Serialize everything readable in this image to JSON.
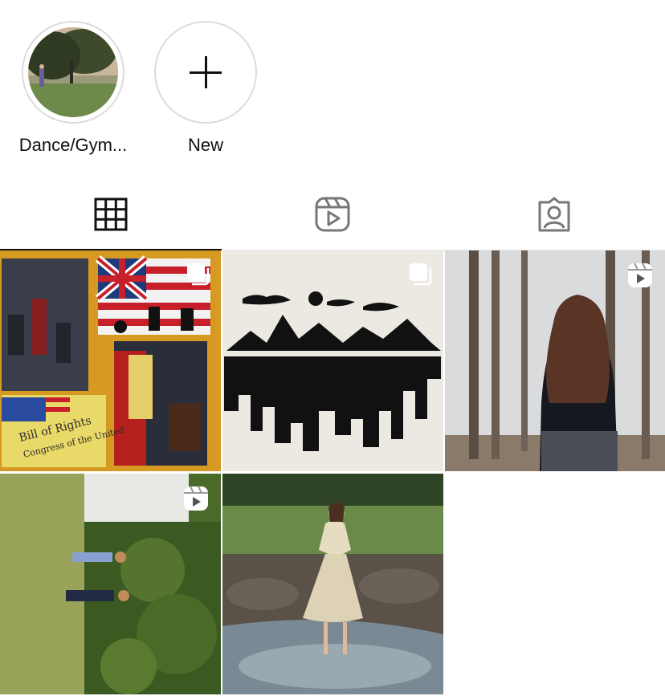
{
  "highlights": [
    {
      "label": "Dance/Gym..."
    },
    {
      "label": "New"
    }
  ],
  "tabs": [
    {
      "icon": "grid-icon",
      "active": true
    },
    {
      "icon": "reels-icon",
      "active": false
    },
    {
      "icon": "tagged-icon",
      "active": false
    }
  ],
  "posts": [
    {
      "subject": "social studies painting collage",
      "badge": "carousel-icon"
    },
    {
      "subject": "mountain silhouette drawing",
      "badge": "carousel-icon"
    },
    {
      "subject": "girl in winter woods",
      "badge": "reel-icon"
    },
    {
      "subject": "two girls in yard (rotated)",
      "badge": "reel-icon"
    },
    {
      "subject": "girl in dress by creek",
      "badge": ""
    }
  ]
}
